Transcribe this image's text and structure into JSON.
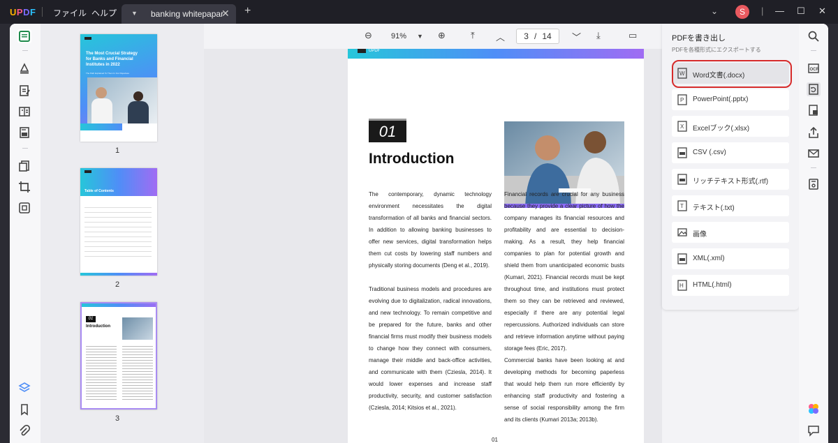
{
  "titlebar": {
    "logo": [
      "U",
      "P",
      "D",
      "F"
    ],
    "menu": [
      "ファイル",
      "ヘルプ"
    ],
    "tab_name": "banking whitepapar",
    "avatar_letter": "S"
  },
  "thumbnails": {
    "labels": [
      "1",
      "2",
      "3"
    ],
    "cover_title": "The Most Crucial Strategy for Banks and Financial Institutes in 2022",
    "cover_sub": "The Path Explained To Them In Our Paperless",
    "toc_title": "Table of Contents",
    "page3_num": "01",
    "page3_title": "Introduction"
  },
  "pagetool": {
    "zoom": "91%",
    "current_page": "3",
    "separator": "/",
    "total_pages": "14"
  },
  "page": {
    "header_label": "UPDF",
    "section_number": "01",
    "heading": "Introduction",
    "col1_p1": "The contemporary, dynamic technology environment necessitates the digital transformation of all banks and financial sectors. In addition to allowing banking businesses to offer new services, digital transformation helps them cut costs by lowering staff numbers and physically storing documents (Deng et al., 2019).",
    "col1_p2": "Traditional business models and procedures are evolving due to digitalization, radical innovations, and new technology. To remain competitive and be prepared for the future, banks and other financial firms must modify their business models to change how they connect with consumers, manage their middle and back-office activities, and communicate with them (Cziesla, 2014). It would lower expenses and increase staff productivity, security, and customer satisfaction (Cziesla, 2014; Kitsios et al., 2021).",
    "col2_p1": "Financial records are crucial for any business because they provide a clear picture of how the company manages its financial resources and profitability and are essential to decision-making. As a result, they help financial companies to plan for potential growth and shield them from unanticipated economic busts (Kumari, 2021). Financial records must be kept throughout time, and institutions must protect them so they can be retrieved and reviewed, especially if there are any potential legal repercussions. Authorized individuals can store and retrieve information anytime without paying storage fees (Eric, 2017).",
    "col2_p2": "Commercial banks have been looking at and developing methods for becoming paperless that would help them run more efficiently by enhancing staff productivity and fostering a sense of social responsibility among the firm and its clients (Kumari 2013a; 2013b).",
    "footer": "01"
  },
  "export": {
    "title": "PDFを書き出し",
    "subtitle": "PDFを各種形式にエクスポートする",
    "items": [
      {
        "label": "Word文書(.docx)",
        "icon": "word-icon"
      },
      {
        "label": "PowerPoint(.pptx)",
        "icon": "powerpoint-icon"
      },
      {
        "label": "Excelブック(.xlsx)",
        "icon": "excel-icon"
      },
      {
        "label": "CSV (.csv)",
        "icon": "csv-icon"
      },
      {
        "label": "リッチテキスト形式(.rtf)",
        "icon": "rtf-icon"
      },
      {
        "label": "テキスト(.txt)",
        "icon": "txt-icon"
      },
      {
        "label": "画像",
        "icon": "image-icon"
      },
      {
        "label": "XML(.xml)",
        "icon": "xml-icon"
      },
      {
        "label": "HTML(.html)",
        "icon": "html-icon"
      }
    ]
  },
  "colors": {
    "accent": "#4f8ef7",
    "highlight": "#d62b2b",
    "titlebar": "#1f1f26"
  }
}
